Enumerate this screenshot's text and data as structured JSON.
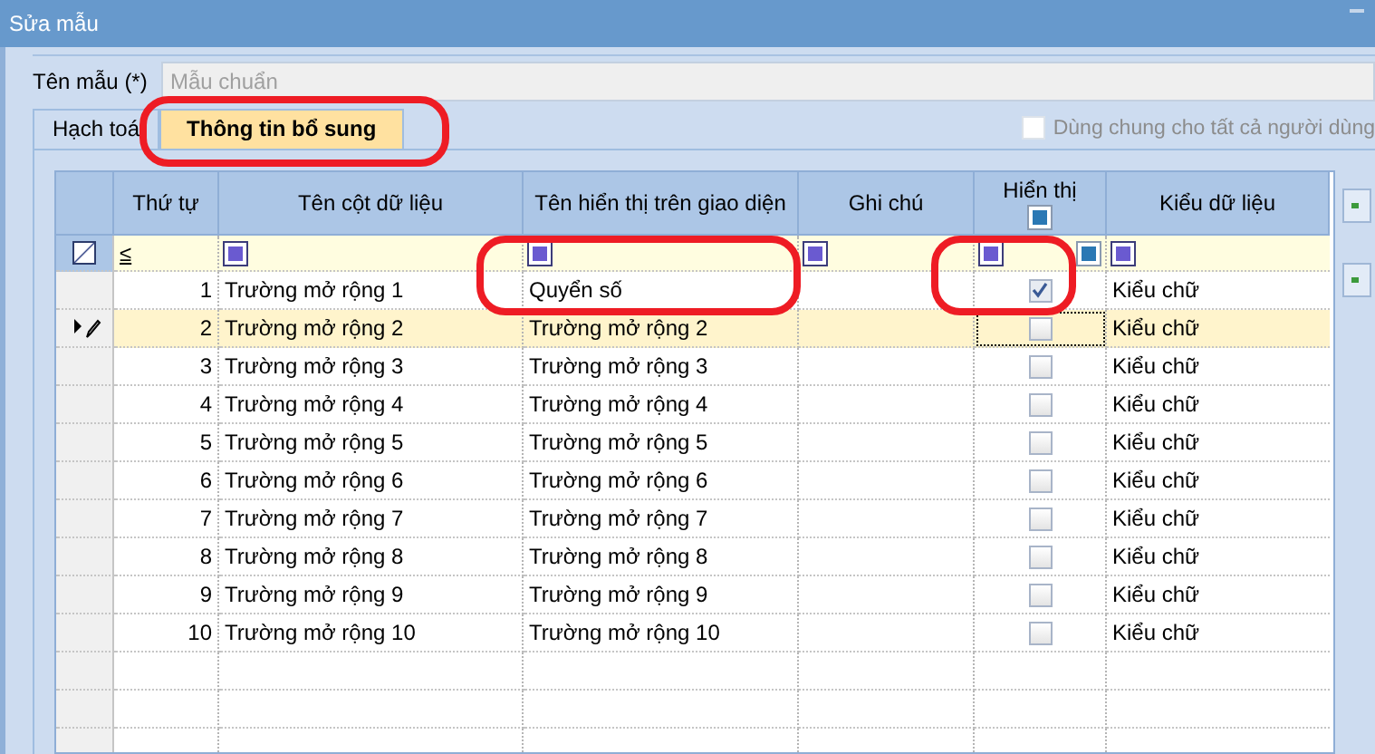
{
  "window": {
    "title": "Sửa mẫu"
  },
  "name_field": {
    "label": "Tên mẫu (*)",
    "value": "Mẫu chuẩn",
    "disabled": true
  },
  "tabs": [
    {
      "label": "Hạch toá",
      "selected": false
    },
    {
      "label": "Thông tin bổ sung",
      "selected": true
    }
  ],
  "share_checkbox": {
    "label": "Dùng chung cho tất cả người dùng",
    "checked": false,
    "disabled": true
  },
  "table": {
    "columns": [
      {
        "label": "Thứ tự",
        "kind": "number"
      },
      {
        "label": "Tên cột dữ liệu",
        "kind": "text"
      },
      {
        "label": "Tên hiển thị trên giao diện",
        "kind": "text"
      },
      {
        "label": "Ghi chú",
        "kind": "text"
      },
      {
        "label": "Hiển thị",
        "kind": "check"
      },
      {
        "label": "Kiểu dữ liệu",
        "kind": "text"
      }
    ],
    "filter_operator": "≤",
    "rows": [
      {
        "cells": [
          "1",
          "Trường mở rộng 1",
          "Quyển số",
          "",
          true,
          "Kiểu chữ"
        ],
        "selected": false
      },
      {
        "cells": [
          "2",
          "Trường mở rộng 2",
          "Trường mở rộng 2",
          "",
          false,
          "Kiểu chữ"
        ],
        "selected": true
      },
      {
        "cells": [
          "3",
          "Trường mở rộng 3",
          "Trường mở rộng 3",
          "",
          false,
          "Kiểu chữ"
        ],
        "selected": false
      },
      {
        "cells": [
          "4",
          "Trường mở rộng 4",
          "Trường mở rộng 4",
          "",
          false,
          "Kiểu chữ"
        ],
        "selected": false
      },
      {
        "cells": [
          "5",
          "Trường mở rộng 5",
          "Trường mở rộng 5",
          "",
          false,
          "Kiểu chữ"
        ],
        "selected": false
      },
      {
        "cells": [
          "6",
          "Trường mở rộng 6",
          "Trường mở rộng 6",
          "",
          false,
          "Kiểu chữ"
        ],
        "selected": false
      },
      {
        "cells": [
          "7",
          "Trường mở rộng 7",
          "Trường mở rộng 7",
          "",
          false,
          "Kiểu chữ"
        ],
        "selected": false
      },
      {
        "cells": [
          "8",
          "Trường mở rộng 8",
          "Trường mở rộng 8",
          "",
          false,
          "Kiểu chữ"
        ],
        "selected": false
      },
      {
        "cells": [
          "9",
          "Trường mở rộng 9",
          "Trường mở rộng 9",
          "",
          false,
          "Kiểu chữ"
        ],
        "selected": false
      },
      {
        "cells": [
          "10",
          "Trường mở rộng 10",
          "Trường mở rộng 10",
          "",
          false,
          "Kiểu chữ"
        ],
        "selected": false
      }
    ]
  },
  "annotations": [
    {
      "kind": "ellipse"
    },
    {
      "kind": "ellipse"
    },
    {
      "kind": "ellipse"
    }
  ]
}
